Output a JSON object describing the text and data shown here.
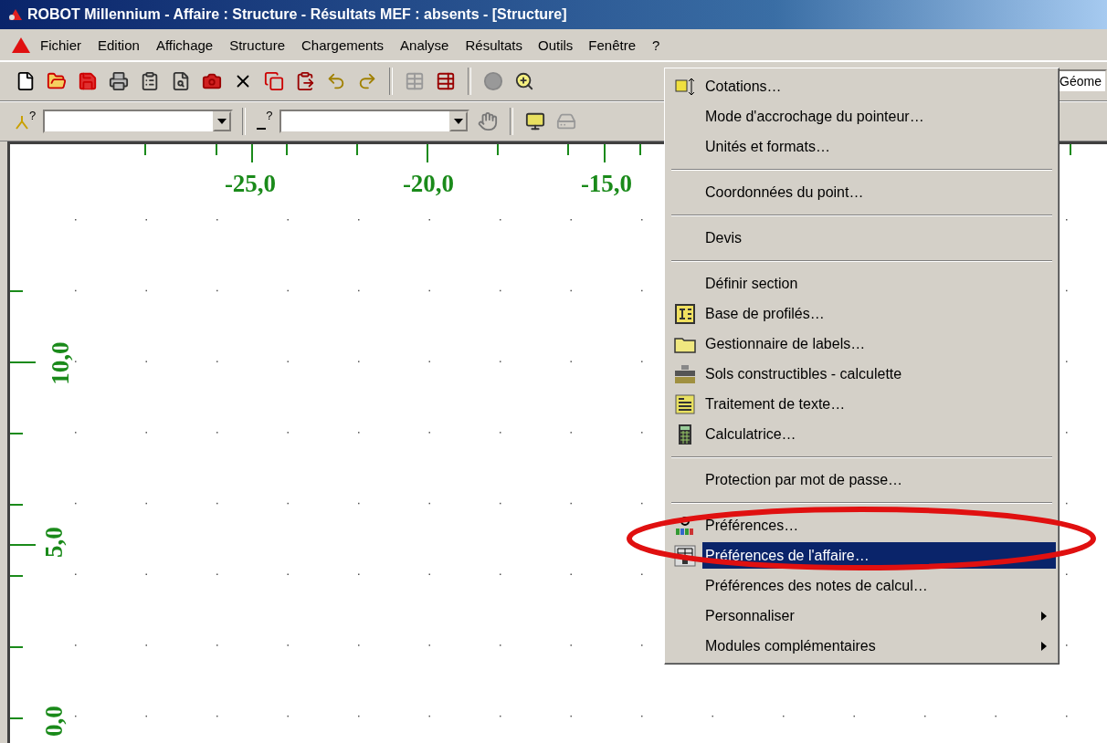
{
  "title_bar": {
    "title": "ROBOT Millennium - Affaire : Structure - Résultats MEF : absents - [Structure]"
  },
  "menu_bar": [
    {
      "label": "Fichier",
      "selected": false
    },
    {
      "label": "Edition",
      "selected": false
    },
    {
      "label": "Affichage",
      "selected": false
    },
    {
      "label": "Structure",
      "selected": false
    },
    {
      "label": "Chargements",
      "selected": false
    },
    {
      "label": "Analyse",
      "selected": false
    },
    {
      "label": "Résultats",
      "selected": false
    },
    {
      "label": "Outils",
      "selected": true
    },
    {
      "label": "Fenêtre",
      "selected": false
    },
    {
      "label": "?",
      "selected": false
    }
  ],
  "toolbar_main": {
    "view_field": {
      "value": "Géome"
    }
  },
  "toolbar_selection": {
    "selectors": [
      {
        "icon_mark": "?"
      },
      {
        "icon_mark": "?"
      }
    ]
  },
  "canvas": {
    "x_labels": [
      "-25,0",
      "-20,0",
      "-15,0"
    ],
    "y_labels": [
      "10,0",
      "5,0",
      "0,0"
    ]
  },
  "tools_menu": {
    "items": [
      {
        "kind": "command",
        "label": "Cotations…",
        "selected": false
      },
      {
        "kind": "command",
        "label": "Mode d'accrochage du pointeur…",
        "selected": false
      },
      {
        "kind": "command",
        "label": "Unités et formats…",
        "selected": false
      },
      {
        "kind": "separator"
      },
      {
        "kind": "command",
        "label": "Coordonnées du point…",
        "selected": false
      },
      {
        "kind": "separator"
      },
      {
        "kind": "command",
        "label": "Devis",
        "selected": false
      },
      {
        "kind": "separator"
      },
      {
        "kind": "command",
        "label": "Définir section",
        "selected": false
      },
      {
        "kind": "command",
        "label": "Base de profilés…",
        "selected": false
      },
      {
        "kind": "command",
        "label": "Gestionnaire de labels…",
        "selected": false
      },
      {
        "kind": "command",
        "label": "Sols constructibles - calculette",
        "selected": false
      },
      {
        "kind": "command",
        "label": "Traitement de texte…",
        "selected": false
      },
      {
        "kind": "command",
        "label": "Calculatrice…",
        "selected": false
      },
      {
        "kind": "separator"
      },
      {
        "kind": "command",
        "label": "Protection par mot de passe…",
        "selected": false
      },
      {
        "kind": "separator"
      },
      {
        "kind": "command",
        "label": "Préférences…",
        "selected": false
      },
      {
        "kind": "command",
        "label": "Préférences de l'affaire…",
        "selected": true
      },
      {
        "kind": "command",
        "label": "Préférences des notes de calcul…",
        "selected": false
      },
      {
        "kind": "submenu",
        "label": "Personnaliser",
        "selected": false
      },
      {
        "kind": "submenu",
        "label": "Modules complémentaires",
        "selected": false
      }
    ]
  }
}
